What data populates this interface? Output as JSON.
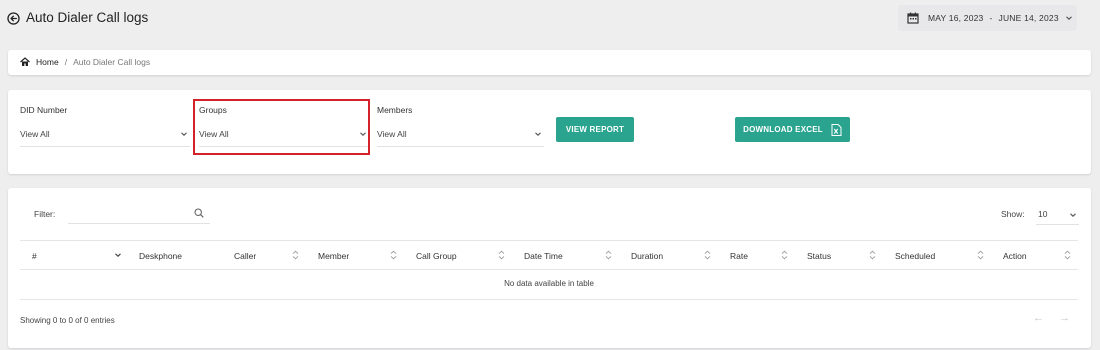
{
  "header": {
    "title": "Auto Dialer Call logs",
    "date_start": "MAY 16, 2023",
    "date_sep": "-",
    "date_end": "JUNE 14, 2023"
  },
  "breadcrumb": {
    "home": "Home",
    "separator": "/",
    "current": "Auto Dialer Call logs"
  },
  "filters": {
    "did": {
      "label": "DID Number",
      "value": "View All"
    },
    "groups": {
      "label": "Groups",
      "value": "View All"
    },
    "members": {
      "label": "Members",
      "value": "View All"
    },
    "view_report": "VIEW REPORT",
    "download_excel": "DOWNLOAD EXCEL"
  },
  "table": {
    "filter_label": "Filter:",
    "filter_value": "",
    "show_label": "Show:",
    "page_size": "10",
    "columns": [
      "#",
      "Deskphone",
      "Caller",
      "Member",
      "Call Group",
      "Date Time",
      "Duration",
      "Rate",
      "Status",
      "Scheduled",
      "Action"
    ],
    "empty_message": "No data available in table",
    "info": "Showing 0 to 0 of 0 entries",
    "prev": "←",
    "next": "→"
  },
  "colors": {
    "accent": "#2aa38f",
    "highlight": "#d3222a",
    "background": "#eeeeef"
  },
  "icons": [
    "back-arrow-icon",
    "calendar-icon",
    "chevron-down-icon",
    "home-icon",
    "excel-icon",
    "search-icon",
    "sort-icon"
  ]
}
